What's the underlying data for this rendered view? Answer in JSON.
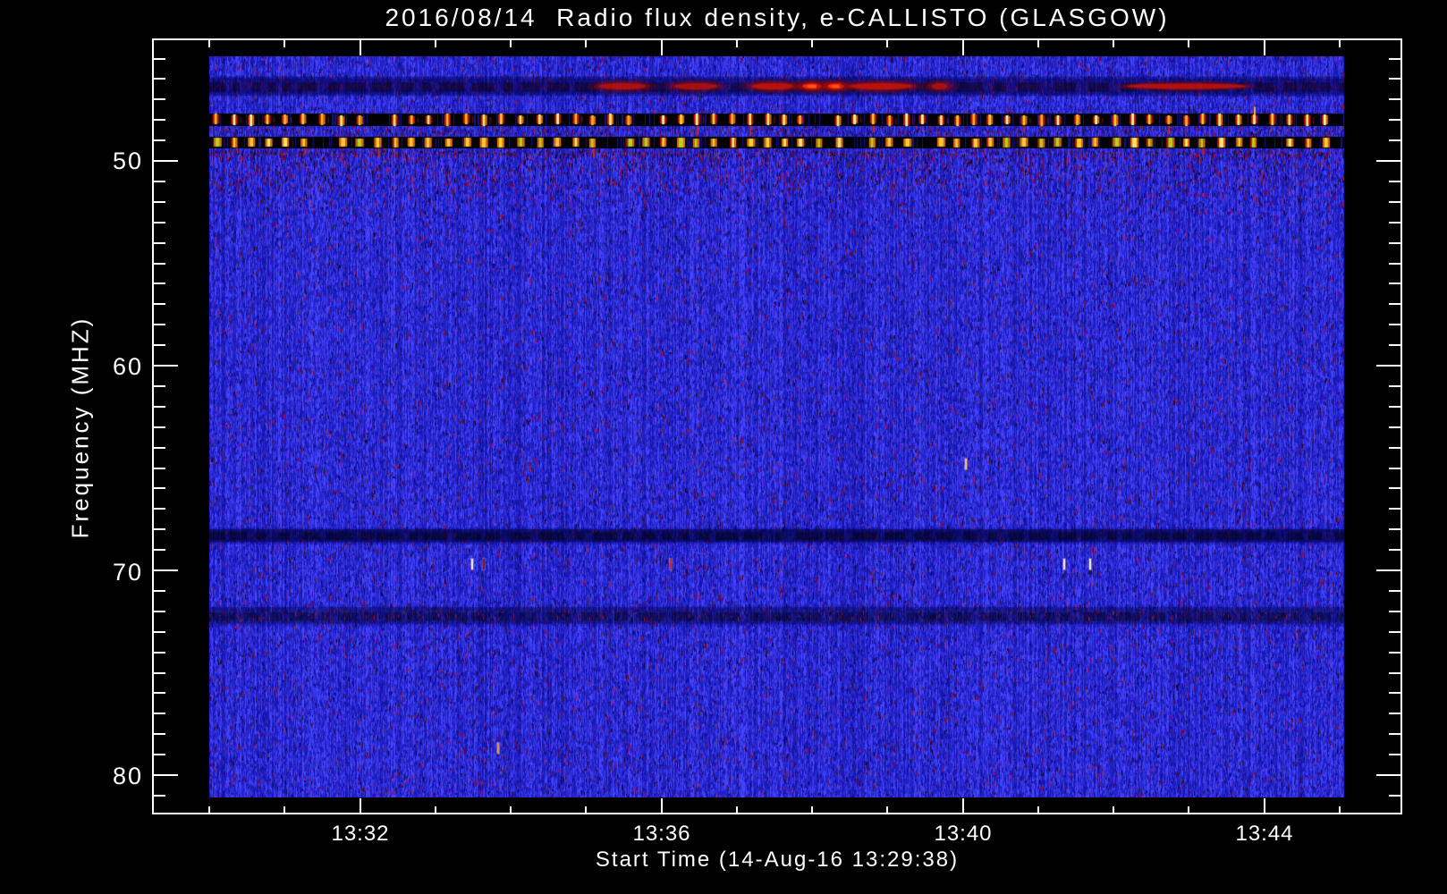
{
  "page": {
    "background": "#000000",
    "text_color": "#ffffff"
  },
  "header": {
    "title": "2016/08/14  Radio flux density, e-CALLISTO (GLASGOW)"
  },
  "chart_data": {
    "type": "heatmap",
    "title": "2016/08/14  Radio flux density, e-CALLISTO (GLASGOW)",
    "xlabel": "Start Time (14-Aug-16 13:29:38)",
    "ylabel": "Frequency (MHZ)",
    "x_tick_labels": [
      "13:32",
      "13:36",
      "13:40",
      "13:44"
    ],
    "y_tick_labels": [
      "50",
      "60",
      "70",
      "80"
    ],
    "x_data_start": "13:30:00",
    "x_data_end": "13:45:04",
    "x_minor_step_min": 1,
    "y_minor_step_mhz": 1,
    "y_data_range_mhz": [
      44.9,
      81.1
    ],
    "y_axis_range_mhz": [
      44.1,
      81.9
    ],
    "y_axis_inverted": true,
    "grid": false,
    "legend": false,
    "colormap": "blue background, red-orange-yellow for strong flux",
    "background_noise": {
      "base_color": "#1e1ed2",
      "dark_color": "#0c0aa0",
      "bright_color": "#3c3cf2",
      "speckle_color": "#701038",
      "speckle_density": 0.045
    },
    "features": {
      "emission_band": {
        "freq_mhz": 46.35,
        "color_core": "#e01606",
        "color_halo": "#6e0a14",
        "blobs": [
          {
            "start": "13:35:10",
            "end": "13:35:48",
            "intensity": 0.4
          },
          {
            "start": "13:36:10",
            "end": "13:36:45",
            "intensity": 0.3
          },
          {
            "start": "13:37:12",
            "end": "13:37:46",
            "intensity": 0.6
          },
          {
            "start": "13:37:52",
            "end": "13:38:08",
            "intensity": 1.0
          },
          {
            "start": "13:38:12",
            "end": "13:38:26",
            "intensity": 1.0
          },
          {
            "start": "13:38:30",
            "end": "13:39:20",
            "intensity": 0.6
          },
          {
            "start": "13:39:35",
            "end": "13:39:48",
            "intensity": 0.35
          },
          {
            "start": "13:42:11",
            "end": "13:43:45",
            "intensity": 0.5
          }
        ]
      },
      "rfi_bands": [
        {
          "name": "rfi-band-48MHz",
          "freq_range_mhz": [
            47.7,
            48.3
          ],
          "background": "#000000",
          "dash_period_s": 14,
          "dash_colors": [
            "#cf1202",
            "#ffd22a",
            "#e86a00"
          ]
        },
        {
          "name": "rfi-band-49MHz",
          "freq_range_mhz": [
            48.8,
            49.4
          ],
          "background": "#000000",
          "dash_period_s": 14,
          "dash_colors": [
            "#e86a00",
            "#ffe76e",
            "#b9d020",
            "#cf1202"
          ]
        }
      ],
      "dark_bands": [
        {
          "freq_range_mhz": [
            46.0,
            46.7
          ],
          "style": "smooth"
        },
        {
          "freq_range_mhz": [
            68.0,
            68.6
          ],
          "style": "smooth"
        },
        {
          "freq_range_mhz": [
            71.8,
            72.6
          ],
          "style": "speckled"
        }
      ],
      "speckle_zone": {
        "freq_range_mhz": [
          49.5,
          52.8
        ]
      },
      "specks": [
        {
          "time": "13:33:29",
          "freq_mhz": 69.7,
          "color": "#f2f2ff"
        },
        {
          "time": "13:33:38",
          "freq_mhz": 69.7,
          "color": "#8c1020"
        },
        {
          "time": "13:36:07",
          "freq_mhz": 69.7,
          "color": "#d02018"
        },
        {
          "time": "13:41:20",
          "freq_mhz": 69.7,
          "color": "#ffe9f2"
        },
        {
          "time": "13:41:41",
          "freq_mhz": 69.7,
          "color": "#fff2a0"
        },
        {
          "time": "13:40:02",
          "freq_mhz": 64.8,
          "color": "#ffc070"
        },
        {
          "time": "13:33:49",
          "freq_mhz": 78.7,
          "color": "#ff9020"
        }
      ]
    }
  }
}
